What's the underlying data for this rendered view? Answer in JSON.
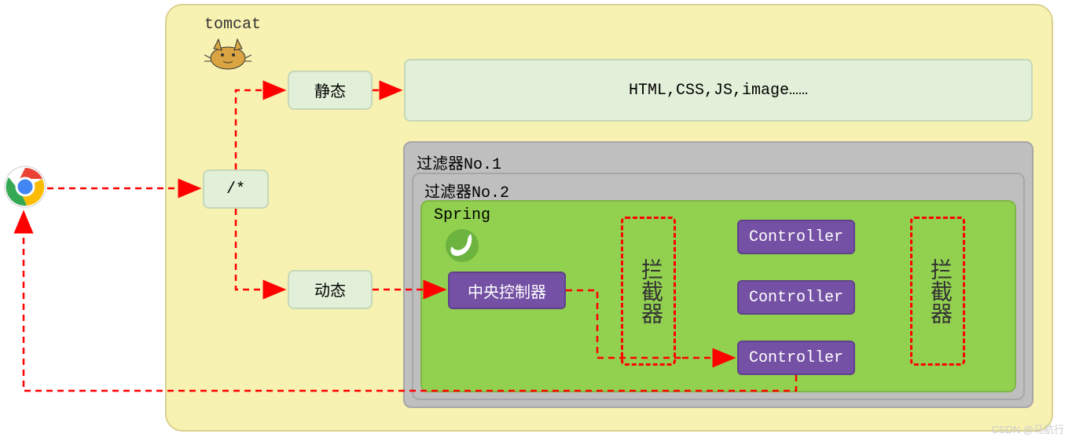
{
  "tomcat": {
    "label": "tomcat"
  },
  "nodes": {
    "static": "静态",
    "star": "/*",
    "dynamic": "动态",
    "static_content": "HTML,CSS,JS,image……"
  },
  "filters": {
    "no1": "过滤器No.1",
    "no2": "过滤器No.2"
  },
  "spring": {
    "label": "Spring",
    "central": "中央控制器",
    "controllers": [
      "Controller",
      "Controller",
      "Controller"
    ],
    "interceptor": "拦截器"
  },
  "watermark": "CSDN @马航行",
  "colors": {
    "tomcat_bg": "#F8F2B2",
    "green": "#E2F0D9",
    "grey": "#BFBFBF",
    "spring_green": "#92D050",
    "purple": "#7451A4",
    "arrow_red": "#FF0000"
  }
}
